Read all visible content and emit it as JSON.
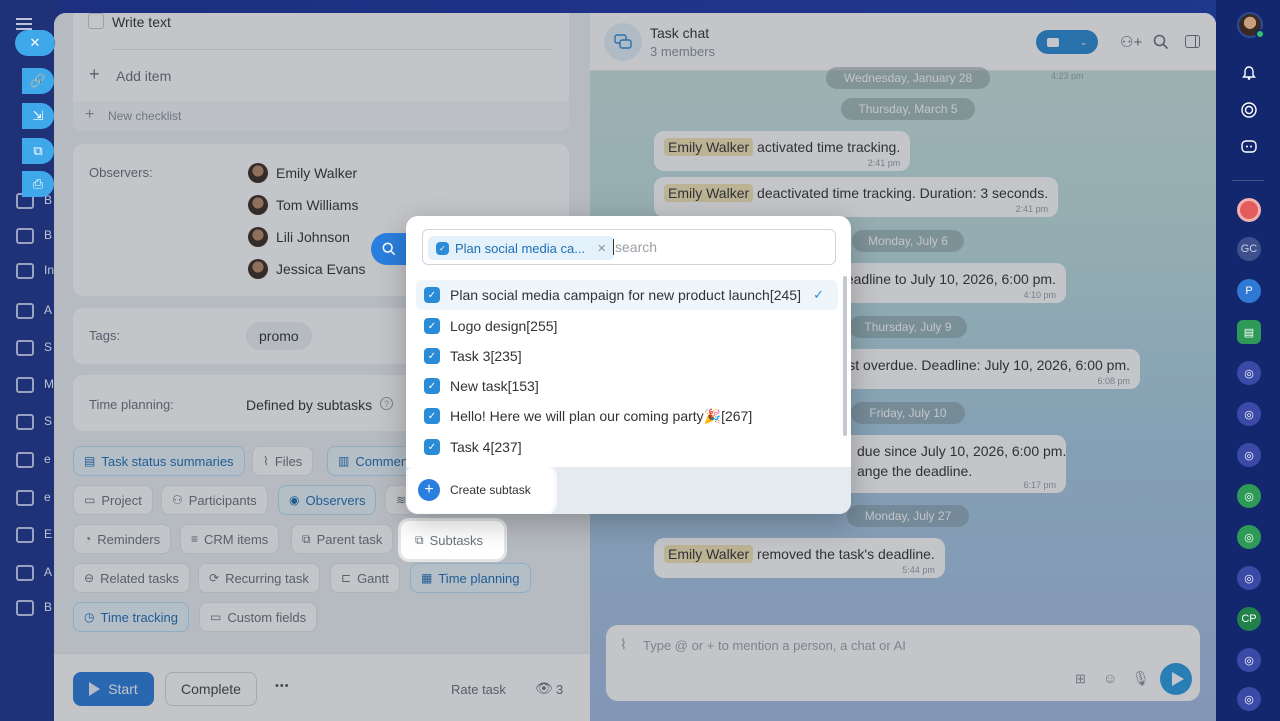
{
  "leftnav": {
    "letters": [
      "B",
      "In",
      "A",
      "S",
      "M",
      "S",
      "e",
      "e",
      "E",
      "A",
      "B"
    ],
    "close_icon": "close-icon"
  },
  "checklist": {
    "item_text": "Write text",
    "add_item": "Add item",
    "new_checklist": "New checklist"
  },
  "observers": {
    "label": "Observers:",
    "people": [
      "Emily Walker",
      "Tom Williams",
      "Lili Johnson",
      "Jessica Evans"
    ]
  },
  "tags": {
    "label": "Tags:",
    "tag": "promo"
  },
  "time_planning": {
    "label": "Time planning:",
    "value": "Defined by subtasks"
  },
  "chips": {
    "task_status_summaries": "Task status summaries",
    "files": "Files",
    "comments": "Commen",
    "project": "Project",
    "participants": "Participants",
    "observers": "Observers",
    "reminders": "Reminders",
    "crm_items": "CRM items",
    "parent_task": "Parent task",
    "subtasks": "Subtasks",
    "related_tasks": "Related tasks",
    "recurring_task": "Recurring task",
    "gantt": "Gantt",
    "time_planning": "Time planning",
    "time_tracking": "Time tracking",
    "custom_fields": "Custom fields"
  },
  "footer": {
    "start": "Start",
    "complete": "Complete",
    "more": "•••",
    "rate_task": "Rate task",
    "views": "3"
  },
  "chat": {
    "title": "Task chat",
    "members": "3 members",
    "dates": [
      "Wednesday, January 28",
      "Thursday, March 5",
      "Monday, July 6",
      "Thursday, July 9",
      "Friday, July 10",
      "Monday, July 27"
    ],
    "top_time": "4:23 pm",
    "messages": [
      {
        "name": "Emily Walker",
        "text": "activated time tracking.",
        "time": "2:41 pm"
      },
      {
        "name": "Emily Walker",
        "text": "deactivated time tracking. Duration: 3 seconds.",
        "time": "2:41 pm"
      },
      {
        "text": "eadline to July 10, 2026, 6:00 pm.",
        "time": "4:10 pm"
      },
      {
        "text": "st overdue. Deadline: July 10, 2026, 6:00 pm.",
        "time": "6:08 pm"
      },
      {
        "text": "due since July 10, 2026, 6:00 pm.",
        "text2": "ange the deadline.",
        "time": "6:17 pm"
      },
      {
        "name": "Emily Walker",
        "text": "removed the task's deadline.",
        "time": "5:44 pm"
      }
    ],
    "composer_placeholder": "Type @ or + to mention a person, a chat or AI"
  },
  "popup": {
    "selected_chip": "Plan social media ca...",
    "search_placeholder": "search",
    "items": [
      "Plan social media campaign for new product launch[245]",
      "Logo design[255]",
      "Task 3[235]",
      "New task[153]",
      "Hello! Here we will plan our coming party🎉[267]",
      "Task 4[237]"
    ],
    "create_subtask": "Create subtask"
  },
  "rightbar": {
    "avatars": [
      "GC",
      "P",
      "CP"
    ]
  },
  "colors": {
    "accent": "#2a7fde",
    "chip_active": "#1f6fb5",
    "name_highlight": "#f5e6b8"
  }
}
